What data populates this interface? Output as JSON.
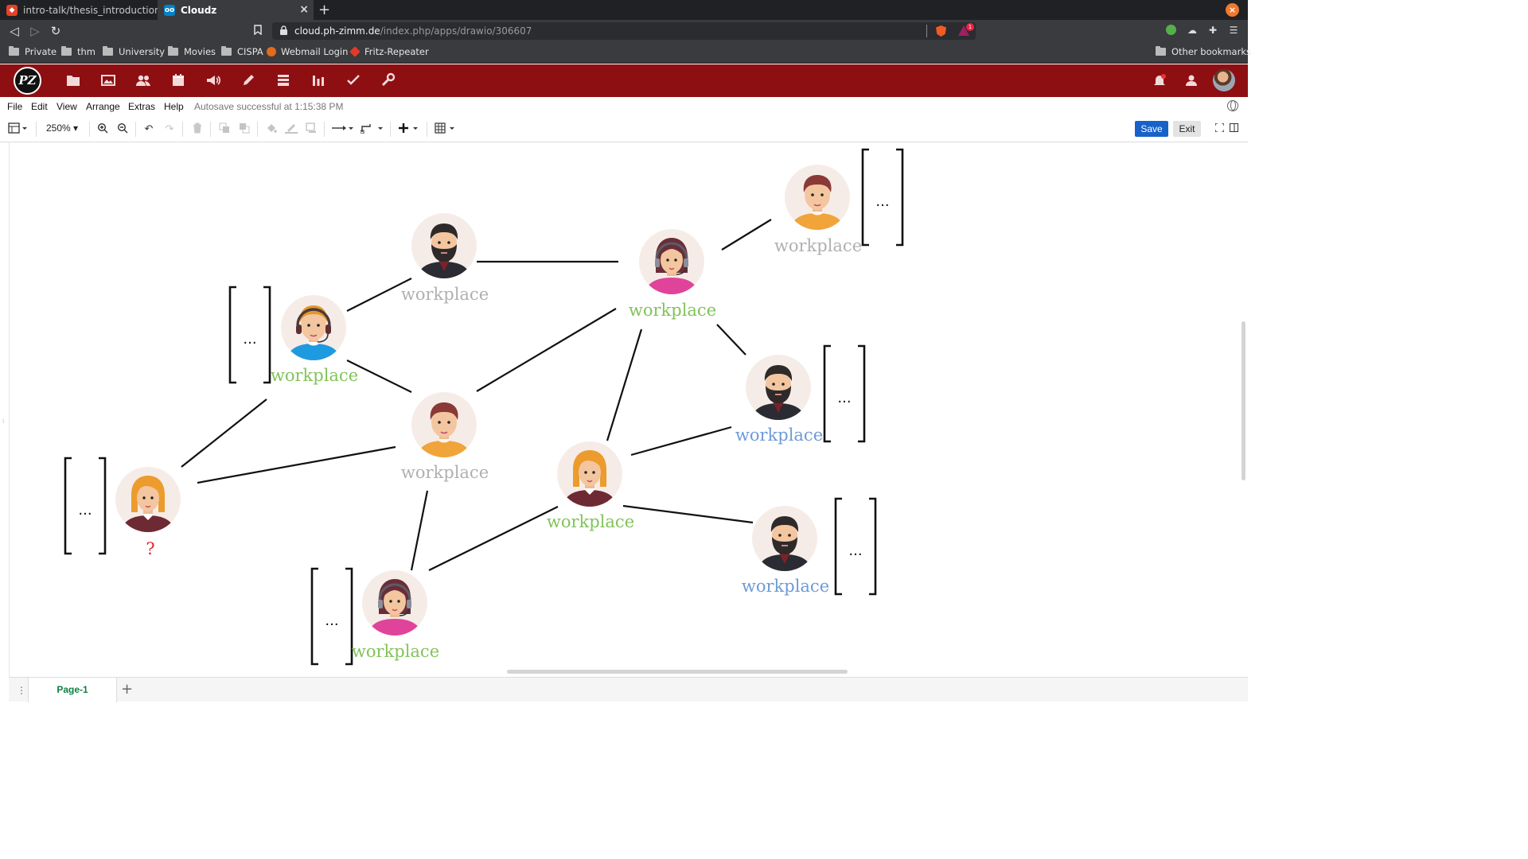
{
  "browser": {
    "tabs": [
      {
        "title": "intro-talk/thesis_introduction.p",
        "icon": "gitlab-icon",
        "active": false
      },
      {
        "title": "Cloudz",
        "icon": "nextcloud-icon",
        "active": true
      }
    ],
    "url_host": "cloud.ph-zimm.de",
    "url_path": "/index.php/apps/drawio/306607",
    "brave_badge": "1",
    "bookmarks": [
      "Private",
      "thm",
      "University",
      "Movies",
      "CISPA",
      "Webmail Login",
      "Fritz-Repeater"
    ],
    "other_bookmarks": "Other bookmarks"
  },
  "nextcloud": {
    "logo_text": "PZ",
    "apps": [
      "files-icon",
      "photos-icon",
      "contacts-icon",
      "calendar-icon",
      "announcements-icon",
      "notes-icon",
      "deck-icon",
      "analytics-icon",
      "tasks-icon",
      "settings-wrench-icon"
    ]
  },
  "drawio": {
    "menus": [
      "File",
      "Edit",
      "View",
      "Arrange",
      "Extras",
      "Help"
    ],
    "autosave": "Autosave successful at 1:15:38 PM",
    "zoom": "250%",
    "save_label": "Save",
    "exit_label": "Exit",
    "page_tab": "Page-1"
  },
  "diagram": {
    "colors": {
      "green": "#82c35a",
      "gray": "#b0b0b0",
      "blue": "#6e9bd6",
      "red": "#e2232a"
    },
    "nodes": [
      {
        "id": "n-bearded-top",
        "label": "workplace",
        "color": "gray",
        "avatar": "bearded-man"
      },
      {
        "id": "n-headset-woman",
        "label": "workplace",
        "color": "green",
        "avatar": "headset-woman"
      },
      {
        "id": "n-man-topright",
        "label": "workplace",
        "color": "gray",
        "avatar": "man"
      },
      {
        "id": "n-headset-man",
        "label": "workplace",
        "color": "green",
        "avatar": "headset-man"
      },
      {
        "id": "n-man-center",
        "label": "workplace",
        "color": "gray",
        "avatar": "man"
      },
      {
        "id": "n-bearded-right",
        "label": "workplace",
        "color": "blue",
        "avatar": "bearded-man"
      },
      {
        "id": "n-blonde-center",
        "label": "workplace",
        "color": "green",
        "avatar": "blonde-woman"
      },
      {
        "id": "n-blonde-left",
        "label": "?",
        "color": "red",
        "avatar": "blonde-woman"
      },
      {
        "id": "n-bearded-bottomright",
        "label": "workplace",
        "color": "blue",
        "avatar": "bearded-man"
      },
      {
        "id": "n-headset-woman-bottom",
        "label": "workplace",
        "color": "green",
        "avatar": "headset-woman"
      }
    ],
    "brackets": [
      "...",
      "...",
      "...",
      "...",
      "...",
      "..."
    ]
  }
}
